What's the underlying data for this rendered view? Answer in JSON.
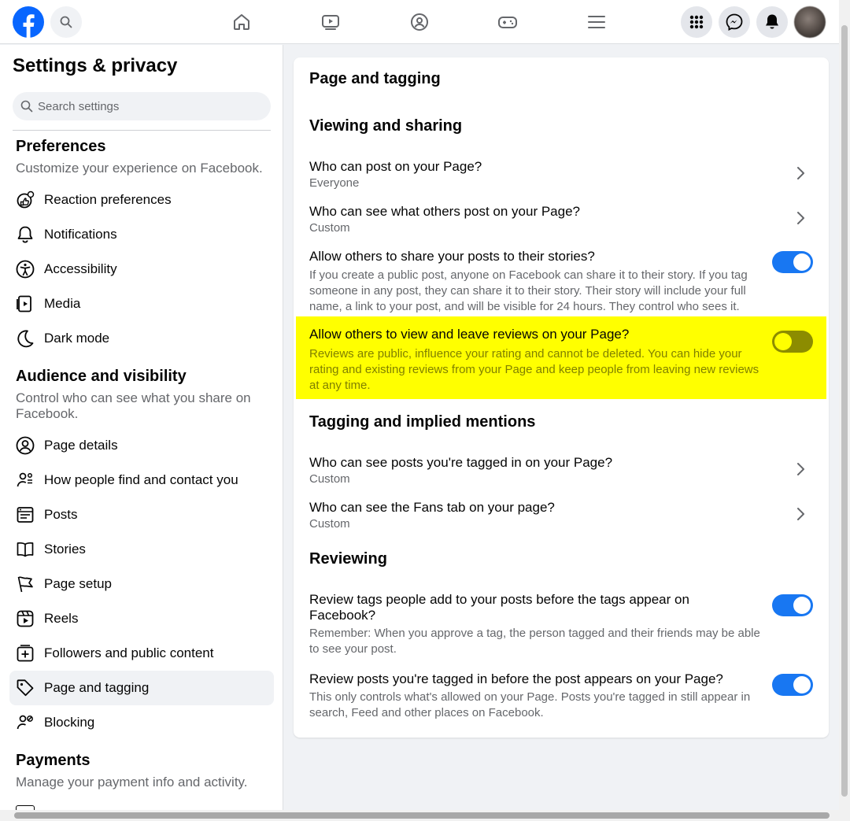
{
  "colors": {
    "accent": "#1877f2",
    "highlight": "#ffff00",
    "secondary_text": "#65676b"
  },
  "topbar": {
    "icons": [
      "facebook-logo",
      "search-icon",
      "home-icon",
      "video-icon",
      "groups-icon",
      "gaming-icon",
      "menu-icon",
      "apps-grid-icon",
      "messenger-icon",
      "bell-icon",
      "avatar"
    ]
  },
  "sidebar": {
    "title": "Settings & privacy",
    "search_placeholder": "Search settings",
    "sections": [
      {
        "title": "Preferences",
        "description": "Customize your experience on Facebook.",
        "items": [
          {
            "label": "Reaction preferences",
            "icon": "reaction-icon"
          },
          {
            "label": "Notifications",
            "icon": "bell-icon"
          },
          {
            "label": "Accessibility",
            "icon": "accessibility-icon"
          },
          {
            "label": "Media",
            "icon": "media-icon"
          },
          {
            "label": "Dark mode",
            "icon": "moon-icon"
          }
        ]
      },
      {
        "title": "Audience and visibility",
        "description": "Control who can see what you share on Facebook.",
        "items": [
          {
            "label": "Page details",
            "icon": "person-circle-icon"
          },
          {
            "label": "How people find and contact you",
            "icon": "people-search-icon"
          },
          {
            "label": "Posts",
            "icon": "posts-icon"
          },
          {
            "label": "Stories",
            "icon": "book-icon"
          },
          {
            "label": "Page setup",
            "icon": "flag-icon"
          },
          {
            "label": "Reels",
            "icon": "reels-icon"
          },
          {
            "label": "Followers and public content",
            "icon": "plus-square-icon"
          },
          {
            "label": "Page and tagging",
            "icon": "tag-icon",
            "active": true
          },
          {
            "label": "Blocking",
            "icon": "block-person-icon"
          }
        ]
      },
      {
        "title": "Payments",
        "description": "Manage your payment info and activity."
      }
    ]
  },
  "main": {
    "title": "Page and tagging",
    "groups": [
      {
        "title": "Viewing and sharing",
        "rows": [
          {
            "title": "Who can post on your Page?",
            "subtitle": "Everyone",
            "control": "chevron"
          },
          {
            "title": "Who can see what others post on your Page?",
            "subtitle": "Custom",
            "control": "chevron"
          },
          {
            "title": "Allow others to share your posts to their stories?",
            "subtitle": "If you create a public post, anyone on Facebook can share it to their story. If you tag someone in any post, they can share it to their story. Their story will include your full name, a link to your post, and will be visible for 24 hours. They control who sees it.",
            "control": "toggle",
            "on": true
          },
          {
            "title": "Allow others to view and leave reviews on your Page?",
            "subtitle": "Reviews are public, influence your rating and cannot be deleted. You can hide your rating and existing reviews from your Page and keep people from leaving new reviews at any time.",
            "control": "toggle",
            "on": false,
            "highlighted": true
          }
        ]
      },
      {
        "title": "Tagging and implied mentions",
        "rows": [
          {
            "title": "Who can see posts you're tagged in on your Page?",
            "subtitle": "Custom",
            "control": "chevron"
          },
          {
            "title": "Who can see the Fans tab on your page?",
            "subtitle": "Custom",
            "control": "chevron"
          }
        ]
      },
      {
        "title": "Reviewing",
        "rows": [
          {
            "title": "Review tags people add to your posts before the tags appear on Facebook?",
            "subtitle": "Remember: When you approve a tag, the person tagged and their friends may be able to see your post.",
            "control": "toggle",
            "on": true
          },
          {
            "title": "Review posts you're tagged in before the post appears on your Page?",
            "subtitle": "This only controls what's allowed on your Page. Posts you're tagged in still appear in search, Feed and other places on Facebook.",
            "control": "toggle",
            "on": true
          }
        ]
      }
    ]
  }
}
